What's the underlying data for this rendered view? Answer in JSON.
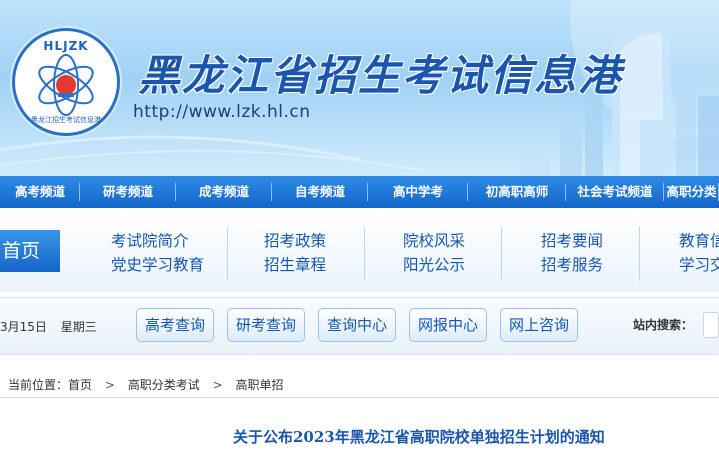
{
  "header": {
    "logo_abbr": "HLJZK",
    "logo_text": "黑龙江招生考试信息港",
    "site_title": "黑龙江省招生考试信息港",
    "site_url": "http://www.lzk.hl.cn"
  },
  "channels": [
    {
      "label": "高考频道"
    },
    {
      "label": "研考频道"
    },
    {
      "label": "成考频道"
    },
    {
      "label": "自考频道"
    },
    {
      "label": "高中学考"
    },
    {
      "label": "初高职高师"
    },
    {
      "label": "社会考试频道"
    },
    {
      "label": "高职分类"
    }
  ],
  "menu": {
    "home_label": "首页",
    "columns": [
      {
        "top": "考试院简介",
        "bottom": "党史学习教育"
      },
      {
        "top": "招考政策",
        "bottom": "招生章程"
      },
      {
        "top": "院校风采",
        "bottom": "阳光公示"
      },
      {
        "top": "招考要闻",
        "bottom": "招考服务"
      },
      {
        "top": "教育信",
        "bottom": "学习交"
      }
    ]
  },
  "toolbar": {
    "date": "3月15日",
    "weekday": "星期三",
    "buttons": [
      {
        "label": "高考查询"
      },
      {
        "label": "研考查询"
      },
      {
        "label": "查询中心"
      },
      {
        "label": "网报中心"
      },
      {
        "label": "网上咨询"
      }
    ],
    "search_label": "站内搜索："
  },
  "breadcrumb": {
    "prefix": "当前位置：",
    "items": [
      "首页",
      "高职分类考试",
      "高职单招"
    ],
    "separator": ">"
  },
  "article": {
    "title": "关于公布2023年黑龙江省高职院校单独招生计划的通知"
  },
  "colors": {
    "primary_blue": "#1366c9",
    "link_blue": "#1557b0",
    "title_blue": "#1a56ad"
  }
}
